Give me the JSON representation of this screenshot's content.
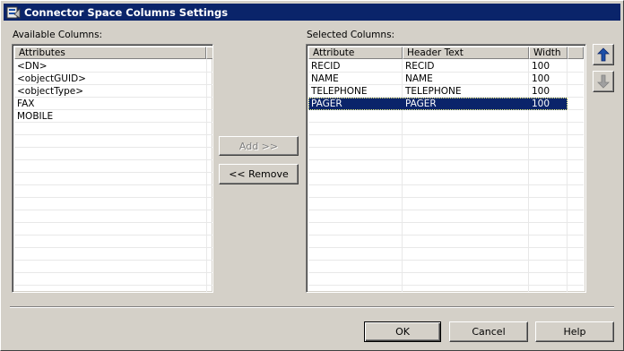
{
  "window": {
    "title": "Connector Space Columns Settings"
  },
  "available": {
    "label": "Available Columns:",
    "header": "Attributes",
    "items": [
      "<DN>",
      "<objectGUID>",
      "<objectType>",
      "FAX",
      "MOBILE"
    ]
  },
  "selected": {
    "label": "Selected Columns:",
    "headers": {
      "attribute": "Attribute",
      "header_text": "Header Text",
      "width": "Width"
    },
    "rows": [
      {
        "attribute": "RECID",
        "header_text": "RECID",
        "width": "100"
      },
      {
        "attribute": "NAME",
        "header_text": "NAME",
        "width": "100"
      },
      {
        "attribute": "TELEPHONE",
        "header_text": "TELEPHONE",
        "width": "100"
      },
      {
        "attribute": "PAGER",
        "header_text": "PAGER",
        "width": "100"
      }
    ],
    "selected_index": 3
  },
  "buttons": {
    "add": "Add >>",
    "remove": "<< Remove",
    "ok": "OK",
    "cancel": "Cancel",
    "help": "Help"
  },
  "icons": {
    "move_up": "arrow-up-icon",
    "move_down": "arrow-down-icon",
    "app": "connector-icon"
  },
  "colors": {
    "titlebar": "#0a246a",
    "dialog_bg": "#d4d0c8",
    "selection": "#0a246a",
    "arrow_up": "#1c4fa8",
    "arrow_disabled": "#808080"
  }
}
